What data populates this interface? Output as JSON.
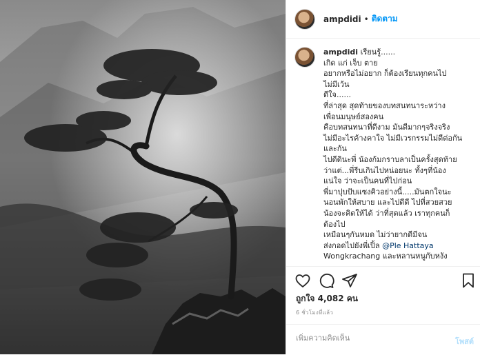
{
  "header": {
    "username": "ampdidi",
    "separator": "•",
    "follow_label": "ติดตาม"
  },
  "caption": {
    "username": "ampdidi",
    "lines": [
      "เรียนรู้......",
      "เกิด แก่ เจ็บ ตาย",
      "อยากหรือไม่อยาก ก็ต้องเรียนทุกคนไป",
      "ไม่มีเว้น",
      "ดีใจ......",
      "ที่ล่าสุด สุดท้ายของบทสนทนาระหว่าง",
      "เพื่อนมนุษย์สองคน",
      "คือบทสนทนาที่ดีงาม มันดีมากๆจริงจริง",
      "ไม่มีอะไรค้างคาใจ ไม่มีเวรกรรมไม่ดีต่อกัน",
      "และกัน",
      "ไปดีดินะพี่ น้องก้มกราบลาเป็นครั้งสุดท้าย",
      "ว่าแต่...พี่รีบเกินไปหน่อยนะ ทั้งๆที่น้อง",
      "แน่ใจ ว่าจะเป็นคนที่ไปก่อน",
      "พี่มาปุบปับแซงคิวอย่างนี้.....มันตกใจนะ",
      "นอนพักให้สบาย และไปดีดี ไปที่สวยสวย",
      "น้องจะคิดให้ได้ ว่าที่สุดแล้ว เราทุกคนก็",
      "ต้องไป",
      "เหมือนๆกันหมด ไม่ว่ายากดีมีจน",
      "ส่งกอดไปยังพี่เปิ้ล ",
      "Wongkrachang และหลานหนูกับหงัง"
    ],
    "mention_prefix": "@Ple Hattaya"
  },
  "actions": {
    "icons": [
      "heart-icon",
      "comment-icon",
      "share-icon",
      "bookmark-icon"
    ]
  },
  "likes": {
    "text": "ถูกใจ 4,082 คน",
    "count": 4082
  },
  "timestamp": "6 ชั่วโมงที่แล้ว",
  "comment_input": {
    "placeholder": "เพิ่มความคิดเห็น",
    "value": ""
  },
  "post_button": "โพสต์"
}
